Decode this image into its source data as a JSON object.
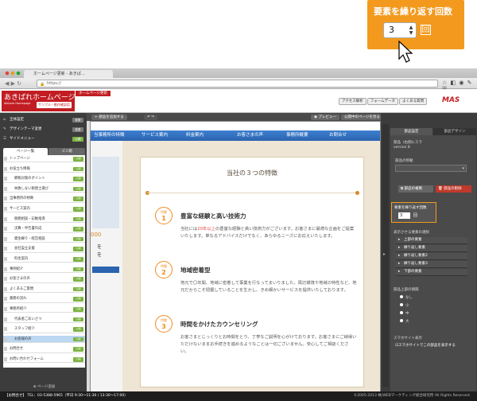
{
  "callout": {
    "title": "要素を繰り返す回数",
    "value": "3",
    "unit": "回"
  },
  "browser": {
    "tab_title": "ホームページ更新 - あきぱ…",
    "url": "https://"
  },
  "app": {
    "logo_main": "あきばれホームページ",
    "logo_sub": "Akibare Homepage",
    "logo_badge": "サンプル・動作確認用",
    "top_tag": "ホームページ更新",
    "topnav": [
      "アクセス解析",
      "フォームデータ",
      "よくある質問"
    ],
    "brand_mark": "MAS"
  },
  "left": {
    "headers": [
      "全体設定",
      "デザインテーマ変更",
      "サイドメニュー"
    ],
    "header_buttons": [
      "変更",
      "変更",
      "公開"
    ],
    "tabs": [
      "ページ一覧",
      "ゴミ箱"
    ],
    "pages": [
      {
        "label": "トップページ",
        "pub": "公開"
      },
      {
        "label": "お役立ち情報",
        "pub": "公開"
      },
      {
        "label": "節税対策のポイント",
        "pub": "公開"
      },
      {
        "label": "失敗しない税理士選び",
        "pub": "公開"
      },
      {
        "label": "当事務所の特徴",
        "pub": "公開"
      },
      {
        "label": "サービス案内",
        "pub": "公開"
      },
      {
        "label": "税務相談・記帳指導",
        "pub": "公開"
      },
      {
        "label": "決算・申告書作成",
        "pub": "公開"
      },
      {
        "label": "資金繰り・経営相談",
        "pub": "公開"
      },
      {
        "label": "会社設立支援",
        "pub": "公開"
      },
      {
        "label": "料金案内",
        "pub": "公開"
      },
      {
        "label": "事例紹介",
        "pub": "公開"
      },
      {
        "label": "お客さまの声",
        "pub": "公開"
      },
      {
        "label": "よくあるご質問",
        "pub": "公開"
      },
      {
        "label": "業務の流れ",
        "pub": "公開"
      },
      {
        "label": "事務所紹介",
        "pub": "公開"
      },
      {
        "label": "代表者ごあいさつ",
        "pub": "公開"
      },
      {
        "label": "スタッフ紹介",
        "pub": "公開"
      },
      {
        "label": "お客様の声",
        "pub": "公開"
      },
      {
        "label": "お問合せ",
        "pub": "公開"
      },
      {
        "label": "お問い合わせフォーム",
        "pub": "公開"
      }
    ],
    "add_page": "ページ追加"
  },
  "center": {
    "toolbar_add": "部品を追加する",
    "toolbar_preview": "プレビュー",
    "toolbar_public": "公開中のページを見る",
    "nav": [
      "当事務所の特徴",
      "サービス案内",
      "料金案内",
      "お客さまの声",
      "事務所概要",
      "お問合せ"
    ],
    "side_text": [
      "000",
      "を",
      "を"
    ],
    "article_title": "当社の３つの特徴",
    "features": [
      {
        "num": "1",
        "tag": "特徴",
        "heading": "豊富な経験と高い技術力",
        "pre": "当社には",
        "red": "20年以上",
        "post": "の豊富な経験と高い技術力がございます。お客さまに最適な企画をご提案いたします。単なるアドバイスだけでなく、あらゆるニーズにお応えいたします。"
      },
      {
        "num": "2",
        "tag": "特徴",
        "heading": "地域密着型",
        "pre": "",
        "red": "",
        "post": "地元で〇年間、地域に密着して事業を行なってまいりました。周辺環境や地域の特性など、地元だからこそ把握していることを生かし、きめ細かいサービスを提供いたしております。"
      },
      {
        "num": "3",
        "tag": "特徴",
        "heading": "時間をかけたカウンセリング",
        "pre": "",
        "red": "",
        "post": "お客さまとじっくりとお時間をとり、丁寧なご説明を心がけております。お客さまにご納得いただけないままお手続きを進めるようなことは一切ございません。安心してご相談ください。"
      }
    ]
  },
  "right": {
    "tabs": [
      "部品設定",
      "部品デザイン"
    ],
    "info": [
      "部品（右側にスラ",
      "version 8"
    ],
    "move_label": "部品の移動",
    "dup_button": "部品の複製",
    "del_button": "部品の削除",
    "repeat_label": "要素を繰り返す回数",
    "repeat_value": "3",
    "repeat_unit": "回",
    "select_label": "表示させる要素の選択",
    "elements": [
      "上部の要素",
      "繰り返し要素",
      "繰り返し要素2",
      "繰り返し要素3",
      "下部の要素"
    ],
    "spacing_label": "部品上部の間隔",
    "spacing_opts": [
      "なし",
      "小",
      "中",
      "大"
    ],
    "sp_label": "スマホサイト表示",
    "sp_check": "スマホサイトでこの部品を表示する"
  },
  "footer": {
    "contact": "【お問合せ】 TEL：03-5388-5965（平日 9:30〜11:30 / 13:30〜17:00）",
    "copyright": "©2005-2013 株)WEBマーケティング総合研究所 All Rights Reserved."
  }
}
